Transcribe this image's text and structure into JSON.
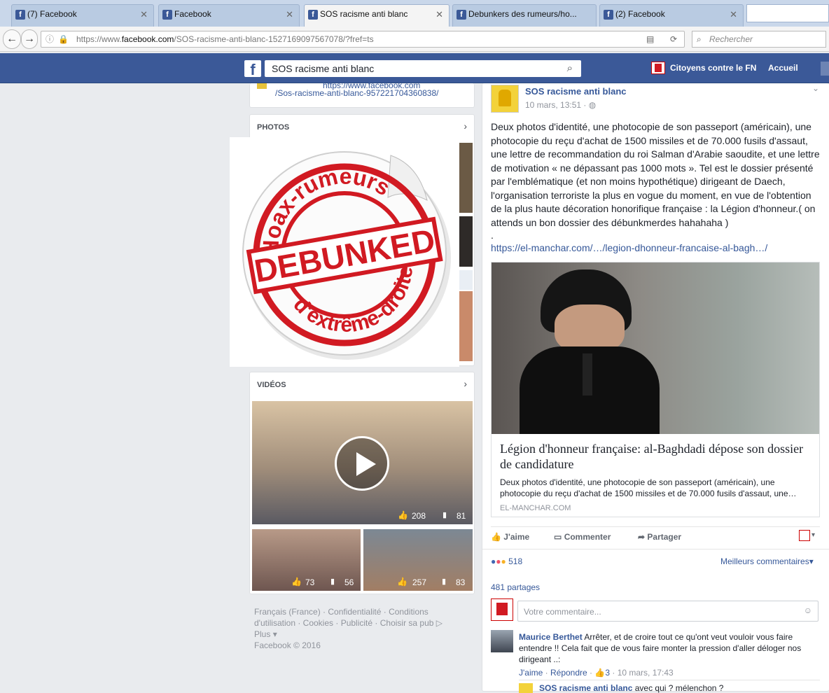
{
  "tabs": [
    {
      "label": "(7) Facebook"
    },
    {
      "label": "Facebook"
    },
    {
      "label": "SOS racisme anti blanc"
    },
    {
      "label": "Debunkers des rumeurs/ho..."
    },
    {
      "label": "(2) Facebook"
    }
  ],
  "browser": {
    "url_prefix": "https://www.",
    "url_domain": "facebook.com",
    "url_path": "/SOS-racisme-anti-blanc-1527169097567078/?fref=ts",
    "search_placeholder": "Rechercher"
  },
  "fb": {
    "search_value": "SOS racisme anti blanc",
    "page_name": "Citoyens contre le FN",
    "home": "Accueil"
  },
  "left": {
    "about_link_1": "https://www.facebook.com",
    "about_link_2": "/Sos-racisme-anti-blanc-957221704360838/",
    "photos_title": "PHOTOS",
    "stamp_top": "Hoax-rumeurs",
    "stamp_mid": "DEBUNKED",
    "stamp_bottom": "d'extrême-droite",
    "videos_title": "VIDÉOS",
    "video_main": {
      "likes": "208",
      "comments": "81"
    },
    "video_small_1": {
      "likes": "73",
      "comments": "56"
    },
    "video_small_2": {
      "likes": "257",
      "comments": "83"
    },
    "footer": {
      "l1": "Français (France)",
      "l2": "Confidentialité",
      "l3": "Conditions",
      "l4": "d'utilisation",
      "l5": "Cookies",
      "l6": "Publicité",
      "l7": "Choisir sa pub",
      "l8": "Plus",
      "l9": "Facebook © 2016"
    }
  },
  "post": {
    "author": "SOS racisme anti blanc",
    "date": "10 mars, 13:51",
    "text": "Deux photos d'identité, une photocopie de son passeport (américain), une photocopie du reçu d'achat de 1500 missiles et de 70.000 fusils d'assaut, une lettre de recommandation du roi Salman d'Arabie saoudite, et une lettre de motivation « ne dépassant pas 1000 mots ». Tel est le dossier présenté par l'emblématique (et non moins hypothétique) dirigeant de Daech, l'organisation terroriste la plus en vogue du moment, en vue de l'obtention de la plus haute décoration honorifique française : la Légion d'honneur.( on attends un bon dossier des débunkmerdes hahahaha )",
    "dot": ".",
    "link": "https://el-manchar.com/…/legion-dhonneur-francaise-al-bagh…/",
    "preview_title": "Légion d'honneur française: al-Baghdadi dépose son dossier de candidature",
    "preview_desc": "Deux photos d'identité, une photocopie de son passeport (américain), une photocopie du reçu d'achat de 1500 missiles et de 70.000 fusils d'assaut, une…",
    "preview_domain": "EL-MANCHAR.COM",
    "like": "J'aime",
    "comment": "Commenter",
    "share": "Partager",
    "reactions": "518",
    "best": "Meilleurs commentaires",
    "shares": "481 partages",
    "comment_placeholder": "Votre commentaire...",
    "c1_author": "Maurice Berthet",
    "c1_text": "Arrêter, et de croire tout ce qu'ont veut vouloir vous faire entendre !! Cela fait que de vous faire monter la pression d'aller déloger nos dirigeant ..:",
    "c1_like": "J'aime",
    "c1_reply": "Répondre",
    "c1_likes": "3",
    "c1_date": "10 mars, 17:43",
    "r1_author": "SOS racisme anti blanc",
    "r1_text": "avec qui ? mélenchon ?"
  },
  "colors": {
    "fb_blue": "#3b5998",
    "link": "#365899",
    "stamp_red": "#d11a22"
  }
}
